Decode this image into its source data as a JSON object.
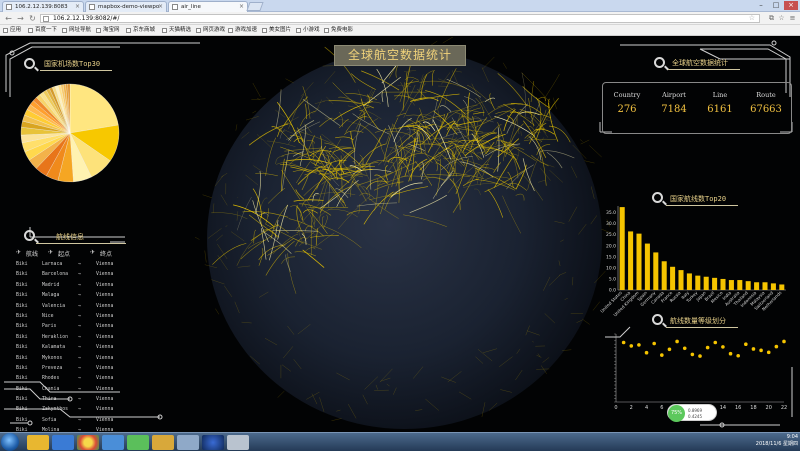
{
  "browser": {
    "tabs": [
      {
        "label": "106.2.12.139:8083"
      },
      {
        "label": "mapbox-demo-viewpo"
      },
      {
        "label": "air_line"
      }
    ],
    "url": "106.2.12.139:8082/#/",
    "bookmarks": [
      "应用",
      "百度一下",
      "网址导航",
      "淘宝网",
      "京东商城",
      "天猫精选",
      "网页游戏",
      "游戏加速",
      "美女图片",
      "小游戏",
      "免费电影"
    ]
  },
  "dashboard": {
    "title": "全球航空数据统计",
    "pie_panel_title": "国家机场数Top30",
    "stats_panel_title": "全球航空数据统计",
    "stats": [
      {
        "label": "Country",
        "value": "276"
      },
      {
        "label": "Airport",
        "value": "7184"
      },
      {
        "label": "Line",
        "value": "6161"
      },
      {
        "label": "Route",
        "value": "67663"
      }
    ],
    "routes_panel_title": "航线信息",
    "routes_headers": {
      "airline": "航线",
      "from": "起点",
      "to": "终点"
    },
    "routes": [
      {
        "airline": "Biki",
        "from": "Larnaca",
        "arrow": "→",
        "to": "Vienna"
      },
      {
        "airline": "Biki",
        "from": "Barcelona",
        "arrow": "→",
        "to": "Vienna"
      },
      {
        "airline": "Biki",
        "from": "Madrid",
        "arrow": "→",
        "to": "Vienna"
      },
      {
        "airline": "Biki",
        "from": "Malaga",
        "arrow": "→",
        "to": "Vienna"
      },
      {
        "airline": "Biki",
        "from": "Valencia",
        "arrow": "→",
        "to": "Vienna"
      },
      {
        "airline": "Biki",
        "from": "Nice",
        "arrow": "→",
        "to": "Vienna"
      },
      {
        "airline": "Biki",
        "from": "Paris",
        "arrow": "→",
        "to": "Vienna"
      },
      {
        "airline": "Biki",
        "from": "Heraklion",
        "arrow": "→",
        "to": "Vienna"
      },
      {
        "airline": "Biki",
        "from": "Kalamata",
        "arrow": "→",
        "to": "Vienna"
      },
      {
        "airline": "Biki",
        "from": "Mykonos",
        "arrow": "→",
        "to": "Vienna"
      },
      {
        "airline": "Biki",
        "from": "Preveza",
        "arrow": "→",
        "to": "Vienna"
      },
      {
        "airline": "Biki",
        "from": "Rhodes",
        "arrow": "→",
        "to": "Vienna"
      },
      {
        "airline": "Biki",
        "from": "Chania",
        "arrow": "→",
        "to": "Vienna"
      },
      {
        "airline": "Biki",
        "from": "Thira",
        "arrow": "→",
        "to": "Vienna"
      },
      {
        "airline": "Biki",
        "from": "Zakynthos",
        "arrow": "→",
        "to": "Vienna"
      },
      {
        "airline": "Biki",
        "from": "Sofia",
        "arrow": "→",
        "to": "Vienna"
      },
      {
        "airline": "Biki",
        "from": "Molina",
        "arrow": "→",
        "to": "Vienna"
      }
    ],
    "bar_panel_title": "国家航线数Top20",
    "scatter_panel_title": "航线数量等级划分",
    "legend": {
      "badge": "75%",
      "line1": "0.8969",
      "line2": "0.4245"
    }
  },
  "taskbar": {
    "time": "9:04",
    "date": "2018/11/6 星期四"
  },
  "colors": {
    "accent": "#f0c040",
    "title_bg": "#6a6858"
  },
  "chart_data": [
    {
      "type": "pie",
      "title": "国家机场数Top30",
      "values": [
        22,
        12,
        8,
        6,
        5,
        4,
        4,
        3.5,
        3,
        3,
        2.5,
        2.5,
        2,
        2,
        2,
        1.8,
        1.6,
        1.5,
        1.4,
        1.3,
        1.2,
        1.1,
        1,
        1,
        0.9,
        0.9,
        0.8,
        0.8,
        0.7,
        0.7
      ]
    },
    {
      "type": "bar",
      "title": "国家航线数Top20",
      "categories": [
        "United States",
        "China",
        "United Kingdom",
        "Spain",
        "Germany",
        "Canada",
        "France",
        "Russia",
        "Italy",
        "Turkey",
        "Japan",
        "Brazil",
        "Mexico",
        "India",
        "Australia",
        "Thailand",
        "Indonesia",
        "Malaysia",
        "Switzerland",
        "Netherlands"
      ],
      "values": [
        37.5,
        26.5,
        25.5,
        21,
        17,
        13,
        10.5,
        9,
        7.5,
        6.5,
        6,
        5.5,
        5,
        4.5,
        4.5,
        4,
        3.5,
        3.5,
        3,
        2.5
      ],
      "yticks": [
        "0.0",
        "5.0",
        "10.0",
        "15.0",
        "20.0",
        "25.0",
        "30.0",
        "35.0"
      ],
      "ylim": [
        0,
        38
      ]
    },
    {
      "type": "scatter",
      "title": "航线数量等级划分",
      "xticks": [
        "0",
        "2",
        "4",
        "6",
        "8",
        "10",
        "12",
        "14",
        "16",
        "18",
        "20",
        "22"
      ],
      "xlim": [
        0,
        22
      ],
      "ylim": [
        0,
        20
      ],
      "points": [
        [
          1,
          17.5
        ],
        [
          2,
          16.5
        ],
        [
          3,
          16.8
        ],
        [
          4,
          14.5
        ],
        [
          5,
          17.2
        ],
        [
          6,
          13.8
        ],
        [
          7,
          15.5
        ],
        [
          8,
          17.8
        ],
        [
          9,
          15.8
        ],
        [
          10,
          14
        ],
        [
          11,
          13.5
        ],
        [
          12,
          16
        ],
        [
          13,
          17.5
        ],
        [
          14,
          16.2
        ],
        [
          15,
          14.2
        ],
        [
          16,
          13.6
        ],
        [
          17,
          17
        ],
        [
          18,
          15.6
        ],
        [
          19,
          15.2
        ],
        [
          20,
          14.6
        ],
        [
          21,
          16.3
        ],
        [
          22,
          17.8
        ]
      ]
    }
  ]
}
